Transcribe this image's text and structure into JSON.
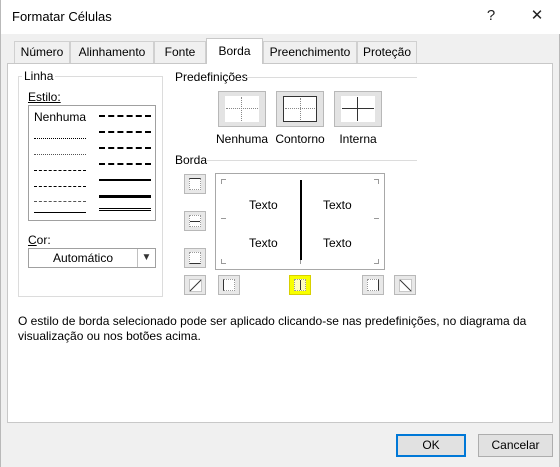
{
  "window": {
    "title": "Formatar Células",
    "help_button": "?",
    "close_button": "✕"
  },
  "tabs": [
    {
      "label": "Número"
    },
    {
      "label": "Alinhamento"
    },
    {
      "label": "Fonte"
    },
    {
      "label": "Borda"
    },
    {
      "label": "Preenchimento"
    },
    {
      "label": "Proteção"
    }
  ],
  "active_tab": "Borda",
  "line_group": {
    "title": "Linha",
    "style_label": "Estilo:",
    "style_none": "Nenhuma",
    "color_label": "Cor:",
    "color_value": "Automático"
  },
  "presets": {
    "title": "Predefinições",
    "items": [
      {
        "label": "Nenhuma"
      },
      {
        "label": "Contorno"
      },
      {
        "label": "Interna"
      }
    ]
  },
  "border": {
    "title": "Borda",
    "preview_text": [
      "Texto",
      "Texto",
      "Texto",
      "Texto"
    ],
    "highlighted_button": "inside-vertical-border-button",
    "highlight_color": "#f8ff00"
  },
  "note": "O estilo de borda selecionado pode ser aplicado clicando-se nas predefinições, no diagrama da visualização ou nos botões acima.",
  "footer": {
    "ok_label": "OK",
    "cancel_label": "Cancelar"
  },
  "colors": {
    "accent": "#0078d7"
  }
}
